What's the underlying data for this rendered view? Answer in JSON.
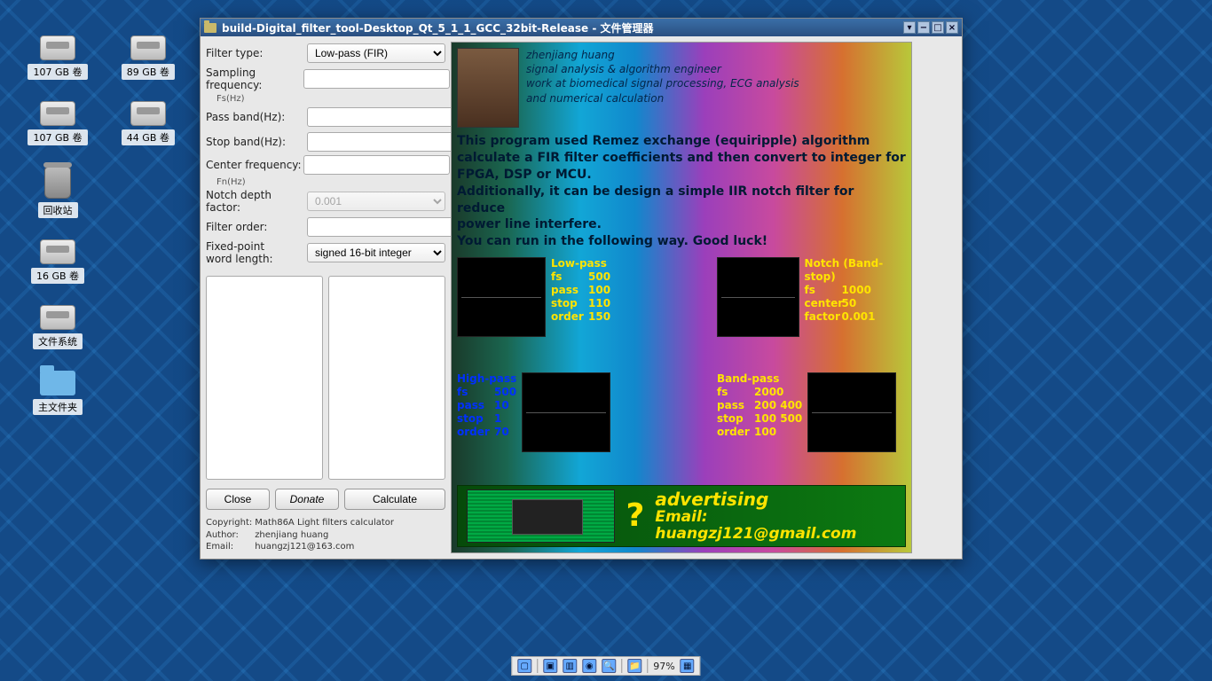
{
  "desktop_icons": [
    {
      "label": "107 GB 卷"
    },
    {
      "label": "89 GB 卷"
    },
    {
      "label": "107 GB 卷"
    },
    {
      "label": "44 GB 卷"
    },
    {
      "label": "回收站"
    },
    {
      "label": "16 GB 卷"
    },
    {
      "label": "文件系统"
    },
    {
      "label": "主文件夹"
    }
  ],
  "window": {
    "title": "build-Digital_filter_tool-Desktop_Qt_5_1_1_GCC_32bit-Release - 文件管理器"
  },
  "form": {
    "filter_type_label": "Filter type:",
    "filter_type_value": "Low-pass (FIR)",
    "sampling_label": "Sampling frequency:",
    "sampling_sub": "Fs(Hz)",
    "pass_band_label": "Pass band(Hz):",
    "stop_band_label": "Stop band(Hz):",
    "center_freq_label": "Center frequency:",
    "center_freq_sub": "Fn(Hz)",
    "notch_depth_label": "Notch depth factor:",
    "notch_depth_value": "0.001",
    "filter_order_label": "Filter order:",
    "fixed_point_label1": "Fixed-point",
    "fixed_point_label2": "word length:",
    "fixed_point_value": "signed 16-bit integer"
  },
  "buttons": {
    "close": "Close",
    "donate": "Donate",
    "calculate": "Calculate"
  },
  "footer": {
    "copyright_k": "Copyright:",
    "copyright_v": "Math86A Light filters calculator",
    "author_k": "Author:",
    "author_v": "zhenjiang huang",
    "email_k": "Email:",
    "email_v": "huangzj121@163.com"
  },
  "profile": {
    "name": "zhenjiang huang",
    "line2": "signal analysis & algorithm engineer",
    "line3": "work at biomedical signal processing, ECG analysis",
    "line4": "and numerical calculation"
  },
  "intro": {
    "l1": "This program used Remez exchange (equiripple) algorithm",
    "l2": "calculate a FIR filter coefficients and then convert to integer for",
    "l3": "FPGA, DSP or MCU.",
    "l4": "Additionally, it can be design a simple IIR notch filter for reduce",
    "l5": "power line interfere.",
    "l6": "You can run in the following way. Good luck!"
  },
  "examples": {
    "lowpass": {
      "title": "Low-pass",
      "fs": "500",
      "pass": "100",
      "stop": "110",
      "order": "150"
    },
    "notch": {
      "title": "Notch (Band-stop)",
      "fs": "1000",
      "center": "50",
      "factor": "0.001"
    },
    "highpass": {
      "title": "High-pass",
      "fs": "500",
      "pass": "10",
      "stop": "1",
      "order": "70"
    },
    "bandpass": {
      "title": "Band-pass",
      "fs": "2000",
      "pass": "200  400",
      "stop": "100  500",
      "order": "100"
    }
  },
  "ad": {
    "q": "?",
    "line1": "advertising",
    "line2": "Email:  huangzj121@gmail.com"
  },
  "taskbar": {
    "percent": "97%"
  }
}
